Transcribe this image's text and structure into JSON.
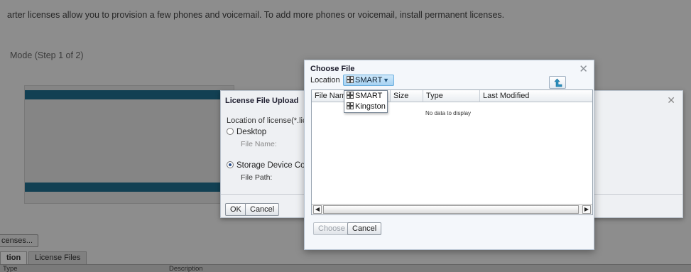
{
  "background": {
    "info_text": "arter licenses allow you to provision a few phones and voicemail. To add more phones or voicemail, install permanent licenses.",
    "step_text": "Mode (Step 1 of 2)",
    "licenses_button": "censes...",
    "tabs": [
      {
        "label": "tion"
      },
      {
        "label": "License Files"
      }
    ],
    "table_headers": {
      "type": "Type",
      "description": "Description"
    }
  },
  "upload_dialog": {
    "title": "License File Upload",
    "location_label": "Location of license(*.lic",
    "desktop_option": "Desktop",
    "file_name_label": "File Name:",
    "storage_option": "Storage Device Con",
    "file_path_label": "File Path:",
    "ok_label": "OK",
    "cancel_label": "Cancel",
    "close_glyph": "✕"
  },
  "choose_dialog": {
    "title": "Choose File",
    "location_label": "Location",
    "location_selected": "SMART",
    "close_glyph": "✕",
    "columns": [
      "File Nam",
      "Size",
      "Type",
      "Last Modified"
    ],
    "empty_message": "No data to display",
    "choose_label": "Choose",
    "cancel_label": "Cancel"
  },
  "location_dropdown": {
    "options": [
      "SMART",
      "Kingston"
    ]
  },
  "icons": {
    "drive": "usb-drive-icon",
    "up_folder": "up-folder-icon",
    "close": "close-icon"
  },
  "colors": {
    "band": "#1f6f8f",
    "select_bg": "#a6d2f2",
    "up_arrow": "#2a8fbf"
  }
}
